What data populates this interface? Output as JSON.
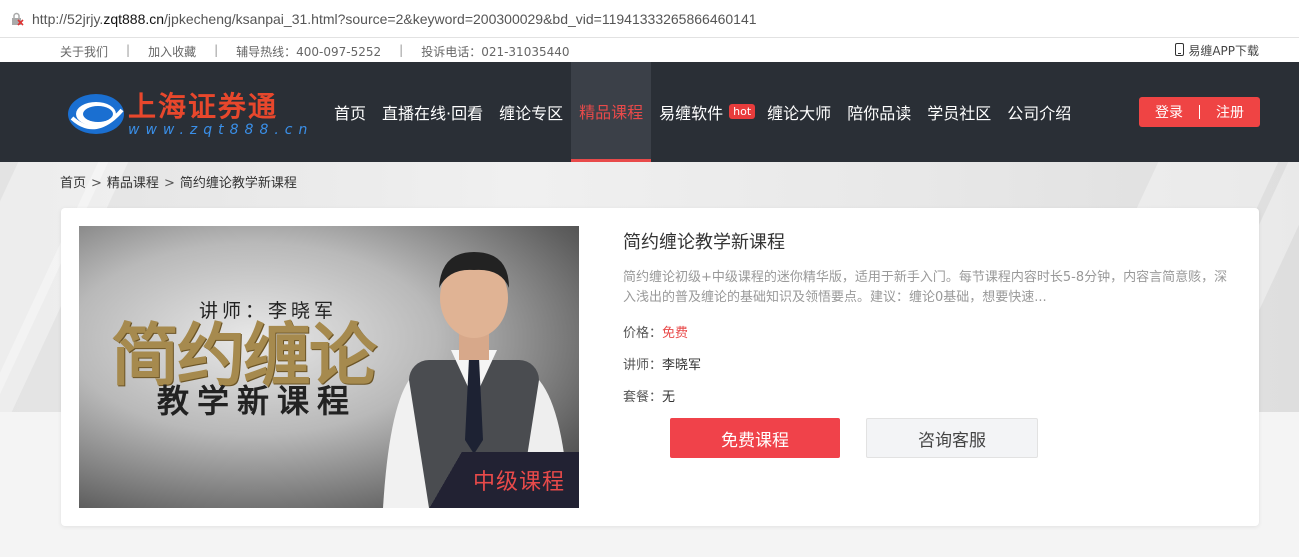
{
  "browser": {
    "url_prefix": "http://52jrjy.",
    "url_domain": "zqt888.cn",
    "url_rest": "/jpkecheng/ksanpai_31.html?source=2&keyword=200300029&bd_vid=11941333265866460141"
  },
  "topbar": {
    "links": [
      "关于我们",
      "加入收藏",
      "辅导热线：400-097-5252",
      "投诉电话：021-31035440"
    ],
    "separator": "|",
    "app_download": "易缠APP下载"
  },
  "header": {
    "logo_text": "上海证券通",
    "logo_url_text": "www.zqt888.cn",
    "nav": [
      {
        "label": "首页"
      },
      {
        "label": "直播在线·回看"
      },
      {
        "label": "缠论专区"
      },
      {
        "label": "精品课程",
        "active": true
      },
      {
        "label": "易缠软件",
        "badge": "hot"
      },
      {
        "label": "缠论大师"
      },
      {
        "label": "陪你品读"
      },
      {
        "label": "学员社区"
      },
      {
        "label": "公司介绍"
      }
    ],
    "login": "登录",
    "register": "注册"
  },
  "breadcrumb": {
    "items": [
      "首页",
      "精品课程",
      "简约缠论教学新课程"
    ],
    "sep": ">"
  },
  "course": {
    "poster": {
      "teacher_line": "讲师：李晓军",
      "big_title": "简约缠论",
      "sub_title": "教学新课程",
      "level": "中级课程"
    },
    "title": "简约缠论教学新课程",
    "description": "简约缠论初级+中级课程的迷你精华版，适用于新手入门。每节课程内容时长5-8分钟，内容言简意赅，深入浅出的普及缠论的基础知识及领悟要点。建议：缠论0基础，想要快速...",
    "price_label": "价格：",
    "price_value": "免费",
    "teacher_label": "讲师：",
    "teacher_value": "李晓军",
    "package_label": "套餐：",
    "package_value": "无",
    "btn_free": "免费课程",
    "btn_service": "咨询客服"
  },
  "colors": {
    "accent": "#e84a4a",
    "header_bg": "#2a2f36"
  }
}
